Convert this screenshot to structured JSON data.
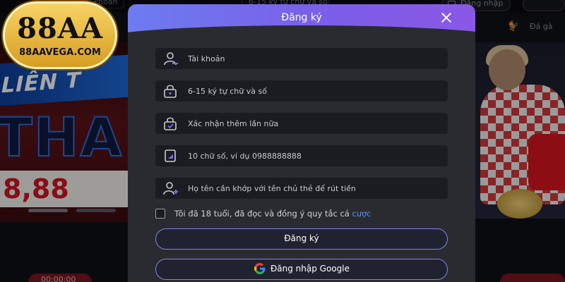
{
  "background": {
    "topbar": {
      "account_label": "Tài khoản",
      "password_hint": "6-15 ký tự chữ và số",
      "login_button": "Đăng nhập"
    },
    "subnav": {
      "item_label": "Đá gà"
    },
    "banner": {
      "strip_text": "LIÊN T",
      "big_text": "THA",
      "amount_text": "8,88"
    },
    "bottom_left_text": "00:00:00"
  },
  "logo": {
    "name": "88AA",
    "domain": "88AAVEGA.COM"
  },
  "modal": {
    "title": "Đăng ký",
    "fields": [
      {
        "icon": "user-icon",
        "placeholder": "Tài khoản"
      },
      {
        "icon": "lock-icon",
        "placeholder": "6-15 ký tự chữ và số"
      },
      {
        "icon": "lock-confirm-icon",
        "placeholder": "Xác nhận thêm lần nữa"
      },
      {
        "icon": "phone-icon",
        "placeholder": "10 chữ số, ví dụ 0988888888"
      },
      {
        "icon": "add-user-icon",
        "placeholder": "Họ tên cần khớp với tên chủ thẻ để rút tiền"
      }
    ],
    "terms": {
      "text": "Tôi đã 18 tuổi, đã đọc và đồng ý quy tắc cá ",
      "link": "cược",
      "checked": false
    },
    "register_button": "Đăng ký",
    "google_button": "Đăng nhập Google"
  },
  "colors": {
    "header_gradient_start": "#6d7cf0",
    "header_gradient_end": "#8a58e6",
    "modal_bg": "#2a2b30",
    "field_bg": "#1b1c21",
    "button_border": "#7f86e8",
    "link": "#5b8df2"
  }
}
